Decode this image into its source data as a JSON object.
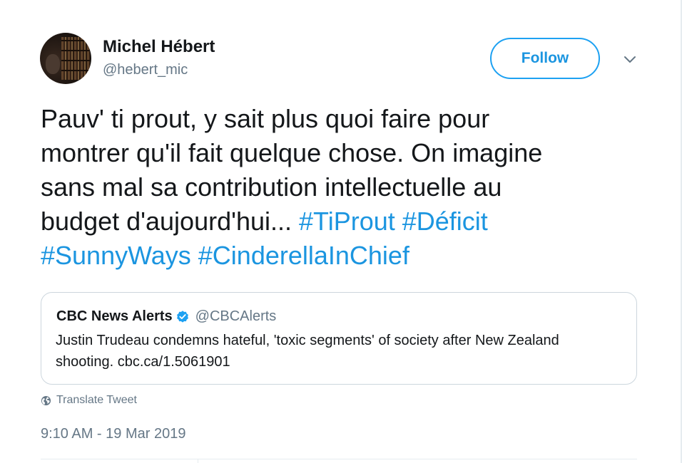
{
  "author": {
    "name": "Michel Hébert",
    "handle": "@hebert_mic"
  },
  "follow_button": {
    "label": "Follow"
  },
  "tweet": {
    "lines": [
      [
        {
          "text": "Pauv' ti prout, y sait plus quoi faire pour"
        }
      ],
      [
        {
          "text": "montrer qu'il fait quelque chose. On imagine"
        }
      ],
      [
        {
          "text": "sans mal sa contribution intellectuelle au"
        }
      ],
      [
        {
          "text": "budget d'aujourd'hui... "
        },
        {
          "text": "#TiProut",
          "hashtag": true
        },
        {
          "text": " "
        },
        {
          "text": "#Déficit",
          "hashtag": true
        }
      ],
      [
        {
          "text": "#SunnyWays",
          "hashtag": true
        },
        {
          "text": " "
        },
        {
          "text": "#CinderellaInChief",
          "hashtag": true
        }
      ]
    ]
  },
  "quoted_tweet": {
    "name": "CBC News Alerts",
    "verified": true,
    "handle": "@CBCAlerts",
    "lines": [
      "Justin Trudeau condemns hateful, 'toxic segments' of society after New Zealand",
      "shooting. cbc.ca/1.5061901"
    ]
  },
  "translate_label": "Translate Tweet",
  "timestamp": "9:10 AM - 19 Mar 2019",
  "colors": {
    "accent": "#1da1f2",
    "link": "#1b95e0",
    "text": "#14171a",
    "secondary": "#657786",
    "border": "#ccd6dd"
  },
  "icons": {
    "caret": "chevron-down-icon",
    "verified": "verified-badge-icon",
    "translate": "globe-icon"
  }
}
